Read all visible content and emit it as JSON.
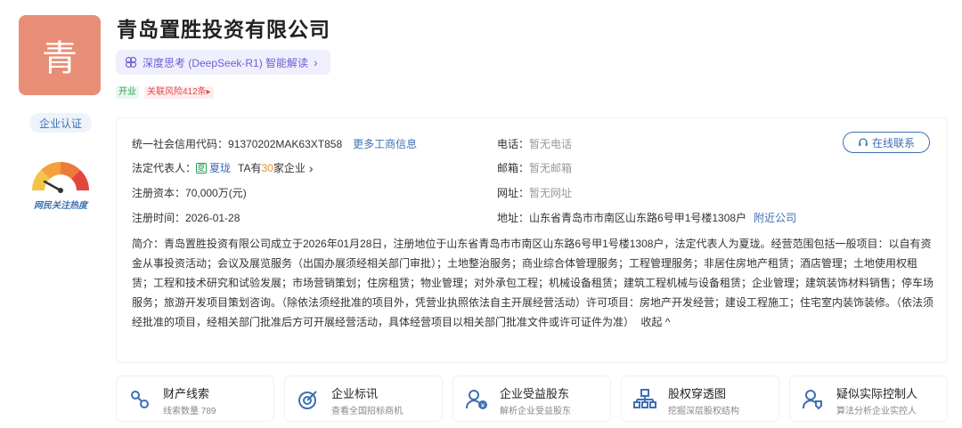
{
  "company": {
    "logo_char": "青",
    "name": "青岛置胜投资有限公司",
    "ai_label": "深度思考 (DeepSeek-R1) 智能解读",
    "ai_arrow": "›",
    "tags": [
      "开业",
      "关联风险412条▸"
    ]
  },
  "side": {
    "cert_label": "企业认证",
    "heat_label": "网民关注热度"
  },
  "info": {
    "credit_label": "统一社会信用代码：",
    "credit_value": "91370202MAK63XT858",
    "more_link": "更多工商信息",
    "phone_label": "电话：",
    "phone_value": "暂无电话",
    "online_btn": "在线联系",
    "legal_label": "法定代表人：",
    "legal_badge": "夏",
    "legal_name": "夏珑",
    "legal_ta_pre": "TA有",
    "legal_ta_count": "30",
    "legal_ta_post": "家企业",
    "legal_arrow": "›",
    "email_label": "邮箱：",
    "email_value": "暂无邮箱",
    "capital_label": "注册资本：",
    "capital_value": "70,000万(元)",
    "site_label": "网址：",
    "site_value": "暂无网址",
    "date_label": "注册时间：",
    "date_value": "2026-01-28",
    "addr_label": "地址：",
    "addr_value": "山东省青岛市市南区山东路6号甲1号楼1308户",
    "nearby_link": "附近公司",
    "intro_text": "简介：青岛置胜投资有限公司成立于2026年01月28日，注册地位于山东省青岛市市南区山东路6号甲1号楼1308户，法定代表人为夏珑。经营范围包括一般项目：以自有资金从事投资活动；会议及展览服务（出国办展须经相关部门审批）；土地整治服务；商业综合体管理服务；工程管理服务；非居住房地产租赁；酒店管理；土地使用权租赁；工程和技术研究和试验发展；市场营销策划；住房租赁；物业管理；对外承包工程；机械设备租赁；建筑工程机械与设备租赁；企业管理；建筑装饰材料销售；停车场服务；旅游开发项目策划咨询。（除依法须经批准的项目外，凭营业执照依法自主开展经营活动）许可项目：房地产开发经营；建设工程施工；住宅室内装饰装修。（依法须经批准的项目，经相关部门批准后方可开展经营活动，具体经营项目以相关部门批准文件或许可证件为准）",
    "collapse_label": "收起 ^"
  },
  "cards": [
    {
      "title": "财产线索",
      "sub": "线索数量 789",
      "icon": "property-clue-icon"
    },
    {
      "title": "企业标讯",
      "sub": "查看全国招标商机",
      "icon": "bid-info-icon"
    },
    {
      "title": "企业受益股东",
      "sub": "解析企业受益股东",
      "icon": "beneficiary-icon"
    },
    {
      "title": "股权穿透图",
      "sub": "挖掘深层股权结构",
      "icon": "equity-tree-icon"
    },
    {
      "title": "疑似实际控制人",
      "sub": "算法分析企业实控人",
      "icon": "controller-icon"
    }
  ],
  "colors": {
    "logo_bg": "#e88e76",
    "link": "#3e6fb5",
    "ai": "#6b5fd6",
    "accent_orange": "#f08a24"
  }
}
